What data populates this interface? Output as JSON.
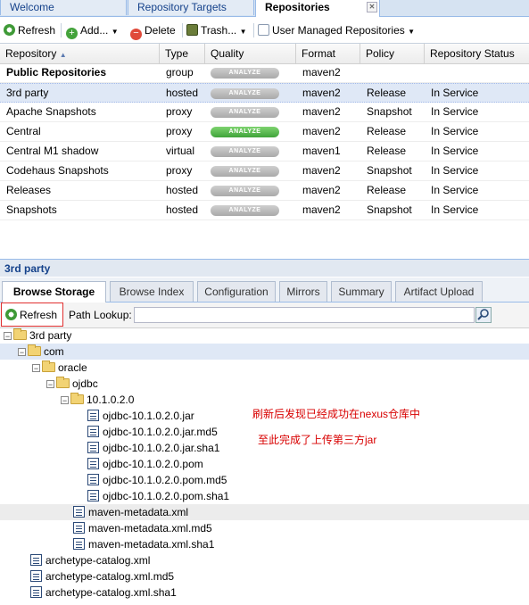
{
  "top_tabs": [
    {
      "label": "Welcome"
    },
    {
      "label": "Repository Targets"
    },
    {
      "label": "Repositories"
    }
  ],
  "toolbar": {
    "refresh": "Refresh",
    "add": "Add...",
    "delete": "Delete",
    "trash": "Trash...",
    "user_managed": "User Managed Repositories"
  },
  "grid": {
    "columns": [
      "Repository",
      "Type",
      "Quality",
      "Format",
      "Policy",
      "Repository Status"
    ],
    "analyze_label": "ANALYZE",
    "rows": [
      {
        "name": "Public Repositories",
        "type": "group",
        "format": "maven2",
        "policy": "",
        "status": ""
      },
      {
        "name": "3rd party",
        "type": "hosted",
        "format": "maven2",
        "policy": "Release",
        "status": "In Service"
      },
      {
        "name": "Apache Snapshots",
        "type": "proxy",
        "format": "maven2",
        "policy": "Snapshot",
        "status": "In Service"
      },
      {
        "name": "Central",
        "type": "proxy",
        "format": "maven2",
        "policy": "Release",
        "status": "In Service"
      },
      {
        "name": "Central M1 shadow",
        "type": "virtual",
        "format": "maven1",
        "policy": "Release",
        "status": "In Service"
      },
      {
        "name": "Codehaus Snapshots",
        "type": "proxy",
        "format": "maven2",
        "policy": "Snapshot",
        "status": "In Service"
      },
      {
        "name": "Releases",
        "type": "hosted",
        "format": "maven2",
        "policy": "Release",
        "status": "In Service"
      },
      {
        "name": "Snapshots",
        "type": "hosted",
        "format": "maven2",
        "policy": "Snapshot",
        "status": "In Service"
      }
    ]
  },
  "detail": {
    "title": "3rd party",
    "tabs": [
      "Browse Storage",
      "Browse Index",
      "Configuration",
      "Mirrors",
      "Summary",
      "Artifact Upload"
    ],
    "refresh": "Refresh",
    "path_lookup_label": "Path Lookup:",
    "path_lookup_value": ""
  },
  "tree": [
    {
      "label": "3rd party"
    },
    {
      "label": "com"
    },
    {
      "label": "oracle"
    },
    {
      "label": "ojdbc"
    },
    {
      "label": "10.1.0.2.0"
    },
    {
      "label": "ojdbc-10.1.0.2.0.jar"
    },
    {
      "label": "ojdbc-10.1.0.2.0.jar.md5"
    },
    {
      "label": "ojdbc-10.1.0.2.0.jar.sha1"
    },
    {
      "label": "ojdbc-10.1.0.2.0.pom"
    },
    {
      "label": "ojdbc-10.1.0.2.0.pom.md5"
    },
    {
      "label": "ojdbc-10.1.0.2.0.pom.sha1"
    },
    {
      "label": "maven-metadata.xml"
    },
    {
      "label": "maven-metadata.xml.md5"
    },
    {
      "label": "maven-metadata.xml.sha1"
    },
    {
      "label": "archetype-catalog.xml"
    },
    {
      "label": "archetype-catalog.xml.md5"
    },
    {
      "label": "archetype-catalog.xml.sha1"
    }
  ],
  "annotations": {
    "line1": "刷新后发现已经成功在nexus仓库中",
    "line2": "至此完成了上传第三方jar"
  },
  "colors": {
    "selection": "#dfe8f6",
    "analyze_green": "#3fa33a",
    "annotation_red": "#d80000",
    "highlight_box": "#e03030"
  }
}
